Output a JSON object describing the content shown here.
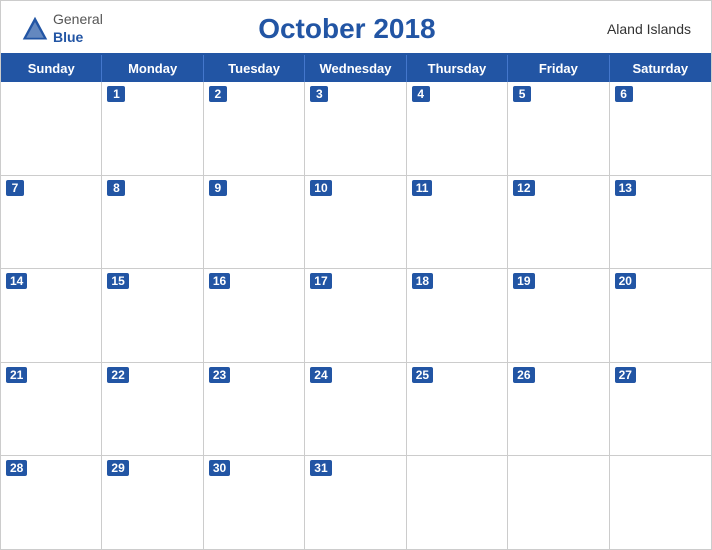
{
  "header": {
    "logo": {
      "general": "General",
      "blue": "Blue",
      "triangle_color": "#2255a4"
    },
    "title": "October 2018",
    "region": "Aland Islands"
  },
  "calendar": {
    "day_headers": [
      "Sunday",
      "Monday",
      "Tuesday",
      "Wednesday",
      "Thursday",
      "Friday",
      "Saturday"
    ],
    "weeks": [
      [
        null,
        1,
        2,
        3,
        4,
        5,
        6
      ],
      [
        7,
        8,
        9,
        10,
        11,
        12,
        13
      ],
      [
        14,
        15,
        16,
        17,
        18,
        19,
        20
      ],
      [
        21,
        22,
        23,
        24,
        25,
        26,
        27
      ],
      [
        28,
        29,
        30,
        31,
        null,
        null,
        null
      ]
    ]
  },
  "colors": {
    "header_bg": "#2255a4",
    "accent": "#2255a4",
    "white": "#ffffff"
  }
}
